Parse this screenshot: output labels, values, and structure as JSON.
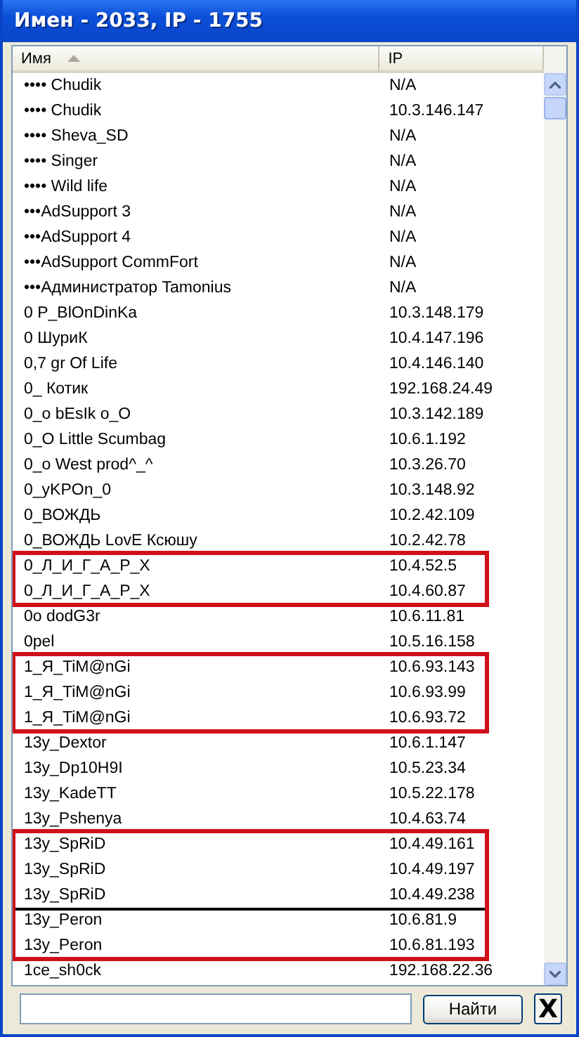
{
  "window": {
    "title": "Имен - 2033, IP - 1755"
  },
  "table": {
    "columns": [
      {
        "label": "Имя",
        "sorted": true
      },
      {
        "label": "IP",
        "sorted": false
      }
    ],
    "rows": [
      {
        "kind": "entry",
        "name": "•••• Chudik",
        "ip": "N/A"
      },
      {
        "kind": "entry",
        "name": "•••• Chudik",
        "ip": "10.3.146.147"
      },
      {
        "kind": "entry",
        "name": "•••• Sheva_SD",
        "ip": "N/A"
      },
      {
        "kind": "entry",
        "name": "•••• Singer",
        "ip": "N/A"
      },
      {
        "kind": "entry",
        "name": "•••• Wild life",
        "ip": "N/A"
      },
      {
        "kind": "entry",
        "name": "•••AdSupport 3",
        "ip": "N/A"
      },
      {
        "kind": "entry",
        "name": "•••AdSupport 4",
        "ip": "N/A"
      },
      {
        "kind": "entry",
        "name": "•••AdSupport CommFort",
        "ip": "N/A"
      },
      {
        "kind": "entry",
        "name": "•••Администратор Tamonius",
        "ip": "N/A"
      },
      {
        "kind": "entry",
        "name": "0 P_BlOnDinKa",
        "ip": "10.3.148.179"
      },
      {
        "kind": "entry",
        "name": "0 ШуриК",
        "ip": "10.4.147.196"
      },
      {
        "kind": "entry",
        "name": "0,7 gr Of Life",
        "ip": "10.4.146.140"
      },
      {
        "kind": "entry",
        "name": "0_ Котик",
        "ip": "192.168.24.49"
      },
      {
        "kind": "entry",
        "name": "0_o bEsIk o_O",
        "ip": "10.3.142.189"
      },
      {
        "kind": "entry",
        "name": "0_O Little Scumbag",
        "ip": "10.6.1.192"
      },
      {
        "kind": "entry",
        "name": "0_o West prod^_^",
        "ip": "10.3.26.70"
      },
      {
        "kind": "entry",
        "name": "0_yKPOn_0",
        "ip": "10.3.148.92"
      },
      {
        "kind": "entry",
        "name": "0_ВОЖДЬ",
        "ip": "10.2.42.109"
      },
      {
        "kind": "entry",
        "name": "0_ВОЖДЬ LovE Ксюшу",
        "ip": "10.2.42.78"
      },
      {
        "kind": "marked",
        "blocks": [
          [
            {
              "name": "0_Л_И_Г_А_Р_Х",
              "ip": "10.4.52.5"
            },
            {
              "name": "0_Л_И_Г_А_Р_Х",
              "ip": "10.4.60.87"
            }
          ]
        ]
      },
      {
        "kind": "entry",
        "name": "0o dodG3r",
        "ip": "10.6.11.81"
      },
      {
        "kind": "entry",
        "name": "0pel",
        "ip": "10.5.16.158"
      },
      {
        "kind": "marked",
        "blocks": [
          [
            {
              "name": "1_Я_TiM@nGi",
              "ip": "10.6.93.143"
            },
            {
              "name": "1_Я_TiM@nGi",
              "ip": "10.6.93.99"
            },
            {
              "name": "1_Я_TiM@nGi",
              "ip": "10.6.93.72"
            }
          ]
        ]
      },
      {
        "kind": "entry",
        "name": "13y_Dextor",
        "ip": "10.6.1.147"
      },
      {
        "kind": "entry",
        "name": "13y_Dp10H9I",
        "ip": "10.5.23.34"
      },
      {
        "kind": "entry",
        "name": "13y_KadeTT",
        "ip": "10.5.22.178"
      },
      {
        "kind": "entry",
        "name": "13y_Pshenya",
        "ip": "10.4.63.74"
      },
      {
        "kind": "marked",
        "blocks": [
          [
            {
              "name": "13y_SpRiD",
              "ip": "10.4.49.161"
            },
            {
              "name": "13y_SpRiD",
              "ip": "10.4.49.197"
            },
            {
              "name": "13y_SpRiD",
              "ip": "10.4.49.238"
            }
          ],
          [
            {
              "name": "13y_Peron",
              "ip": "10.6.81.9"
            },
            {
              "name": "13y_Peron",
              "ip": "10.6.81.193"
            }
          ]
        ]
      },
      {
        "kind": "entry",
        "name": "1ce_sh0ck",
        "ip": "192.168.22.36"
      }
    ]
  },
  "search": {
    "button": "Найти",
    "close": "X"
  }
}
